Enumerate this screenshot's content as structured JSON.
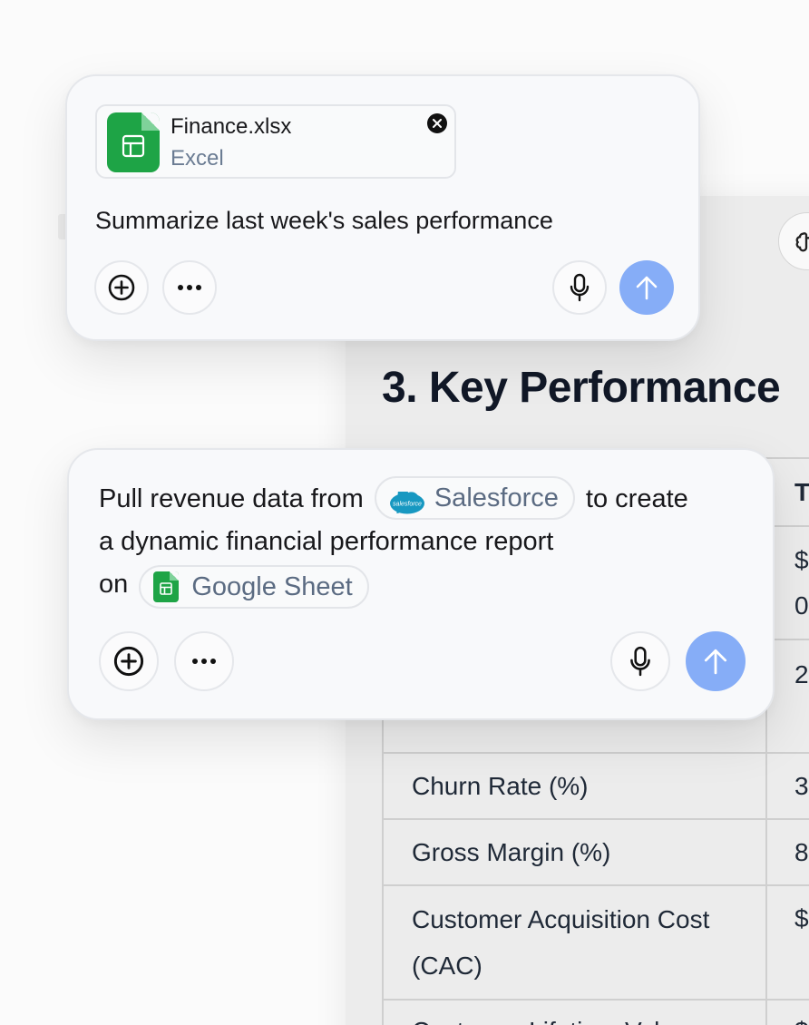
{
  "document": {
    "heading": "3. Key Performance",
    "table": {
      "header": [
        "",
        "T"
      ],
      "rows": [
        {
          "metric": "",
          "value": "$\n0"
        },
        {
          "metric": "",
          "value": "2"
        },
        {
          "metric": "Churn Rate (%)",
          "value": "3"
        },
        {
          "metric": "Gross Margin (%)",
          "value": "8"
        },
        {
          "metric": "Customer Acquisition Cost\n(CAC)",
          "value": "$"
        },
        {
          "metric": "Customer Lifetime Value",
          "value": "$"
        }
      ]
    }
  },
  "composer_1": {
    "attachment": {
      "name": "Finance.xlsx",
      "type": "Excel",
      "icon": "spreadsheet-icon"
    },
    "prompt": "Summarize last week's sales performance",
    "buttons": {
      "add": "plus-circle-icon",
      "more": "ellipsis-icon",
      "mic": "microphone-icon",
      "send": "arrow-up-icon"
    }
  },
  "composer_2": {
    "prompt_parts": {
      "before_chip1": "Pull revenue data from",
      "chip1_label": "Salesforce",
      "after_chip1": "to create",
      "line2": "a dynamic financial performance report",
      "line3_prefix": "on",
      "chip2_label": "Google Sheet"
    },
    "chip1_logo_text": "salesforce",
    "buttons": {
      "add": "plus-circle-icon",
      "more": "ellipsis-icon",
      "mic": "microphone-icon",
      "send": "arrow-up-icon"
    }
  },
  "colors": {
    "send": "#86adf7",
    "sheets_green": "#1ea446",
    "salesforce_blue": "#1798c1",
    "chip_text": "#5b6b82"
  }
}
